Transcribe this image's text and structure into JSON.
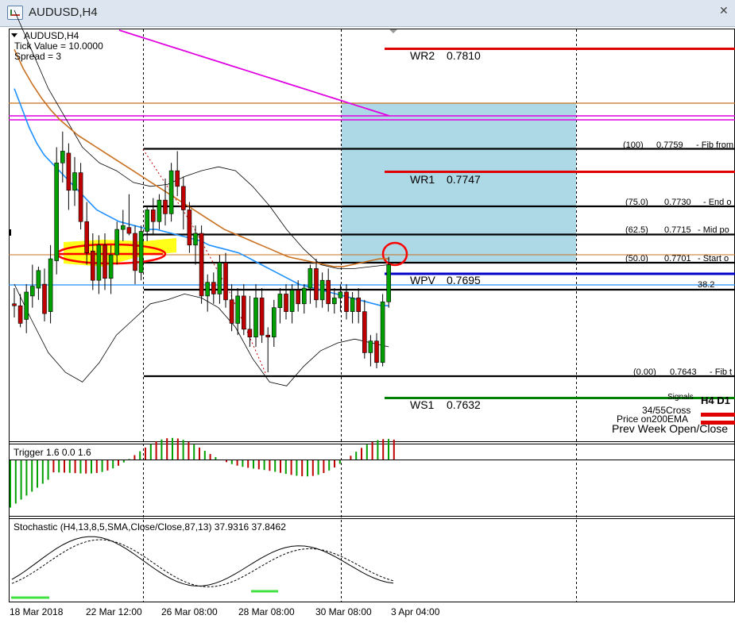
{
  "window": {
    "title": "AUDUSD,H4"
  },
  "info": {
    "symbol": "AUDUSD,H4",
    "tick_value": "Tick Value = 10.0000",
    "spread": "Spread = 3"
  },
  "pivots": [
    {
      "label": "WR2",
      "value": "0.7810",
      "color": "#e00000"
    },
    {
      "label": "WR1",
      "value": "0.7747",
      "color": "#e00000"
    },
    {
      "label": "WPV",
      "value": "0.7695",
      "color": "#0000c8"
    },
    {
      "label": "WS1",
      "value": "0.7632",
      "color": "#008000"
    }
  ],
  "fib_levels": [
    {
      "pct": "(100)",
      "value": "0.7759",
      "note": "- Fib from"
    },
    {
      "pct": "(75.0)",
      "value": "0.7730",
      "note": "- End o"
    },
    {
      "pct": "(62.5)",
      "value": "0.7715",
      "note": "- Mid po"
    },
    {
      "pct": "(50.0)",
      "value": "0.7701",
      "note": "- Start o"
    },
    {
      "pct": "(0.00)",
      "value": "0.7643",
      "note": "- Fib t"
    }
  ],
  "fib_label_38": "38.2",
  "signals": {
    "title": "Signals",
    "tf_header": "H4  D1",
    "row1": "34/55Cross",
    "row2": "Price on200EMA",
    "row3": "Prev Week Open/Close",
    "color_bear": "#e00000"
  },
  "trigger": {
    "label": "Trigger 1.6 0.0 1.6"
  },
  "stochastic": {
    "label": "Stochastic (H4,13,8,5,SMA,Close/Close,87,13) 37.9316 37.8462"
  },
  "x_axis": {
    "labels": [
      "18 Mar 2018",
      "22 Mar 12:00",
      "26 Mar 08:00",
      "28 Mar 08:00",
      "30 Mar 08:00",
      "3 Apr 04:00"
    ]
  },
  "colors": {
    "bull": "#00a000",
    "bear": "#c00000",
    "ma_fast": "#1e90ff",
    "ma_slow": "#c87020",
    "ma_200": "#e000e0",
    "zone": "#add8e6",
    "highlight": "#ffff00",
    "annotation": "#ff0000"
  },
  "chart_data": {
    "type": "candlestick",
    "symbol": "AUDUSD",
    "timeframe": "H4",
    "candles": [
      {
        "o": 0.768,
        "h": 0.7688,
        "l": 0.7673,
        "c": 0.7679
      },
      {
        "o": 0.7679,
        "h": 0.7685,
        "l": 0.7668,
        "c": 0.767
      },
      {
        "o": 0.7672,
        "h": 0.769,
        "l": 0.7665,
        "c": 0.7686
      },
      {
        "o": 0.7684,
        "h": 0.77,
        "l": 0.7678,
        "c": 0.7689
      },
      {
        "o": 0.7688,
        "h": 0.7699,
        "l": 0.7682,
        "c": 0.7697
      },
      {
        "o": 0.769,
        "h": 0.7698,
        "l": 0.7671,
        "c": 0.7675
      },
      {
        "o": 0.7676,
        "h": 0.771,
        "l": 0.767,
        "c": 0.7703
      },
      {
        "o": 0.7702,
        "h": 0.776,
        "l": 0.7695,
        "c": 0.7752
      },
      {
        "o": 0.7752,
        "h": 0.7768,
        "l": 0.7742,
        "c": 0.7758
      },
      {
        "o": 0.7757,
        "h": 0.7762,
        "l": 0.7728,
        "c": 0.7738
      },
      {
        "o": 0.7738,
        "h": 0.7755,
        "l": 0.773,
        "c": 0.7747
      },
      {
        "o": 0.7747,
        "h": 0.7752,
        "l": 0.7718,
        "c": 0.7722
      },
      {
        "o": 0.7722,
        "h": 0.7732,
        "l": 0.77,
        "c": 0.7706
      },
      {
        "o": 0.7707,
        "h": 0.7716,
        "l": 0.7687,
        "c": 0.7692
      },
      {
        "o": 0.7692,
        "h": 0.7715,
        "l": 0.7685,
        "c": 0.771
      },
      {
        "o": 0.771,
        "h": 0.7716,
        "l": 0.7687,
        "c": 0.7693
      },
      {
        "o": 0.7693,
        "h": 0.771,
        "l": 0.7685,
        "c": 0.7705
      },
      {
        "o": 0.7705,
        "h": 0.7722,
        "l": 0.77,
        "c": 0.7718
      },
      {
        "o": 0.7718,
        "h": 0.7728,
        "l": 0.7712,
        "c": 0.772
      },
      {
        "o": 0.7719,
        "h": 0.7736,
        "l": 0.7715,
        "c": 0.7716
      },
      {
        "o": 0.7716,
        "h": 0.772,
        "l": 0.769,
        "c": 0.7697
      },
      {
        "o": 0.7696,
        "h": 0.772,
        "l": 0.7692,
        "c": 0.7717
      },
      {
        "o": 0.7717,
        "h": 0.773,
        "l": 0.7712,
        "c": 0.7728
      },
      {
        "o": 0.7728,
        "h": 0.7734,
        "l": 0.7715,
        "c": 0.7722
      },
      {
        "o": 0.7722,
        "h": 0.7736,
        "l": 0.7718,
        "c": 0.7733
      },
      {
        "o": 0.7733,
        "h": 0.7744,
        "l": 0.772,
        "c": 0.7726
      },
      {
        "o": 0.7726,
        "h": 0.7752,
        "l": 0.7722,
        "c": 0.7748
      },
      {
        "o": 0.7748,
        "h": 0.7758,
        "l": 0.7735,
        "c": 0.774
      },
      {
        "o": 0.774,
        "h": 0.7745,
        "l": 0.7718,
        "c": 0.7728
      },
      {
        "o": 0.7728,
        "h": 0.7732,
        "l": 0.7706,
        "c": 0.771
      },
      {
        "o": 0.771,
        "h": 0.772,
        "l": 0.77,
        "c": 0.7716
      },
      {
        "o": 0.7716,
        "h": 0.772,
        "l": 0.768,
        "c": 0.7684
      },
      {
        "o": 0.7684,
        "h": 0.7695,
        "l": 0.7676,
        "c": 0.7691
      },
      {
        "o": 0.7691,
        "h": 0.7696,
        "l": 0.768,
        "c": 0.7685
      },
      {
        "o": 0.7685,
        "h": 0.7705,
        "l": 0.768,
        "c": 0.7701
      },
      {
        "o": 0.7701,
        "h": 0.7706,
        "l": 0.7678,
        "c": 0.7682
      },
      {
        "o": 0.7682,
        "h": 0.769,
        "l": 0.7666,
        "c": 0.767
      },
      {
        "o": 0.767,
        "h": 0.7688,
        "l": 0.7664,
        "c": 0.7684
      },
      {
        "o": 0.7684,
        "h": 0.769,
        "l": 0.7664,
        "c": 0.7667
      },
      {
        "o": 0.7667,
        "h": 0.7684,
        "l": 0.7658,
        "c": 0.7663
      },
      {
        "o": 0.7663,
        "h": 0.769,
        "l": 0.7658,
        "c": 0.7683
      },
      {
        "o": 0.7683,
        "h": 0.7688,
        "l": 0.766,
        "c": 0.7664
      },
      {
        "o": 0.7664,
        "h": 0.7668,
        "l": 0.7645,
        "c": 0.7663
      },
      {
        "o": 0.7663,
        "h": 0.7682,
        "l": 0.7658,
        "c": 0.7678
      },
      {
        "o": 0.7678,
        "h": 0.7688,
        "l": 0.767,
        "c": 0.7685
      },
      {
        "o": 0.7685,
        "h": 0.769,
        "l": 0.7672,
        "c": 0.7676
      },
      {
        "o": 0.7676,
        "h": 0.769,
        "l": 0.767,
        "c": 0.7687
      },
      {
        "o": 0.7687,
        "h": 0.7692,
        "l": 0.7676,
        "c": 0.768
      },
      {
        "o": 0.768,
        "h": 0.769,
        "l": 0.7675,
        "c": 0.7688
      },
      {
        "o": 0.7688,
        "h": 0.77,
        "l": 0.768,
        "c": 0.7698
      },
      {
        "o": 0.7698,
        "h": 0.7703,
        "l": 0.7678,
        "c": 0.7682
      },
      {
        "o": 0.7682,
        "h": 0.7696,
        "l": 0.7678,
        "c": 0.7692
      },
      {
        "o": 0.7692,
        "h": 0.7698,
        "l": 0.7676,
        "c": 0.768
      },
      {
        "o": 0.768,
        "h": 0.7688,
        "l": 0.7675,
        "c": 0.7683
      },
      {
        "o": 0.7683,
        "h": 0.769,
        "l": 0.7676,
        "c": 0.7686
      },
      {
        "o": 0.7686,
        "h": 0.769,
        "l": 0.7672,
        "c": 0.7676
      },
      {
        "o": 0.7676,
        "h": 0.7686,
        "l": 0.767,
        "c": 0.7683
      },
      {
        "o": 0.7683,
        "h": 0.7688,
        "l": 0.767,
        "c": 0.7676
      },
      {
        "o": 0.7676,
        "h": 0.7682,
        "l": 0.7652,
        "c": 0.7655
      },
      {
        "o": 0.7655,
        "h": 0.7664,
        "l": 0.7648,
        "c": 0.7661
      },
      {
        "o": 0.7661,
        "h": 0.7665,
        "l": 0.7647,
        "c": 0.765
      },
      {
        "o": 0.765,
        "h": 0.7685,
        "l": 0.7648,
        "c": 0.7681
      },
      {
        "o": 0.7681,
        "h": 0.7704,
        "l": 0.7678,
        "c": 0.77
      }
    ],
    "ma_fast": [
      0.779,
      0.778,
      0.777,
      0.7762,
      0.7756,
      0.7752,
      0.7748,
      0.7744,
      0.774,
      0.7736,
      0.7732,
      0.7728,
      0.7726,
      0.7724,
      0.7722,
      0.7721,
      0.772,
      0.7719,
      0.7718,
      0.7718,
      0.7717,
      0.7716,
      0.7715,
      0.7714,
      0.7713,
      0.7712,
      0.771,
      0.7709,
      0.7708,
      0.7707,
      0.7706,
      0.7704,
      0.7702,
      0.77,
      0.7698,
      0.7696,
      0.7694,
      0.7692,
      0.769,
      0.7689,
      0.7688,
      0.7687,
      0.7686,
      0.7685,
      0.7684,
      0.7683,
      0.7682,
      0.7681,
      0.768,
      0.7679,
      0.7679
    ],
    "ma_slow": [
      0.781,
      0.78,
      0.7792,
      0.7785,
      0.7779,
      0.7774,
      0.777,
      0.7766,
      0.7763,
      0.776,
      0.7757,
      0.7754,
      0.7751,
      0.7748,
      0.7745,
      0.7742,
      0.7739,
      0.7736,
      0.7733,
      0.773,
      0.7727,
      0.7724,
      0.7721,
      0.7718,
      0.7716,
      0.7714,
      0.7712,
      0.771,
      0.7708,
      0.7706,
      0.7704,
      0.7703,
      0.7702,
      0.7701,
      0.77,
      0.7699,
      0.7699,
      0.77,
      0.7701,
      0.7702,
      0.7703,
      0.7703
    ],
    "ma_200": [
      0.782,
      0.7815,
      0.781,
      0.7805,
      0.78,
      0.7795,
      0.779,
      0.7785,
      0.778,
      0.7776,
      0.7772,
      0.7769,
      0.7766,
      0.7763,
      0.7761,
      0.7759,
      0.7757,
      0.7756
    ],
    "bb_upper": [
      0.783,
      0.781,
      0.779,
      0.7775,
      0.776,
      0.7752,
      0.7748,
      0.7742,
      0.774,
      0.7741,
      0.7745,
      0.7748,
      0.775,
      0.7748,
      0.774,
      0.773,
      0.7718,
      0.7708,
      0.77,
      0.7698,
      0.7698,
      0.7699,
      0.77
    ],
    "bb_lower": [
      0.769,
      0.7672,
      0.7655,
      0.7645,
      0.764,
      0.765,
      0.7664,
      0.7672,
      0.768,
      0.7682,
      0.7685,
      0.7683,
      0.7678,
      0.7668,
      0.7652,
      0.764,
      0.7638,
      0.7648,
      0.7656,
      0.766,
      0.7662,
      0.766,
      0.7658
    ]
  }
}
